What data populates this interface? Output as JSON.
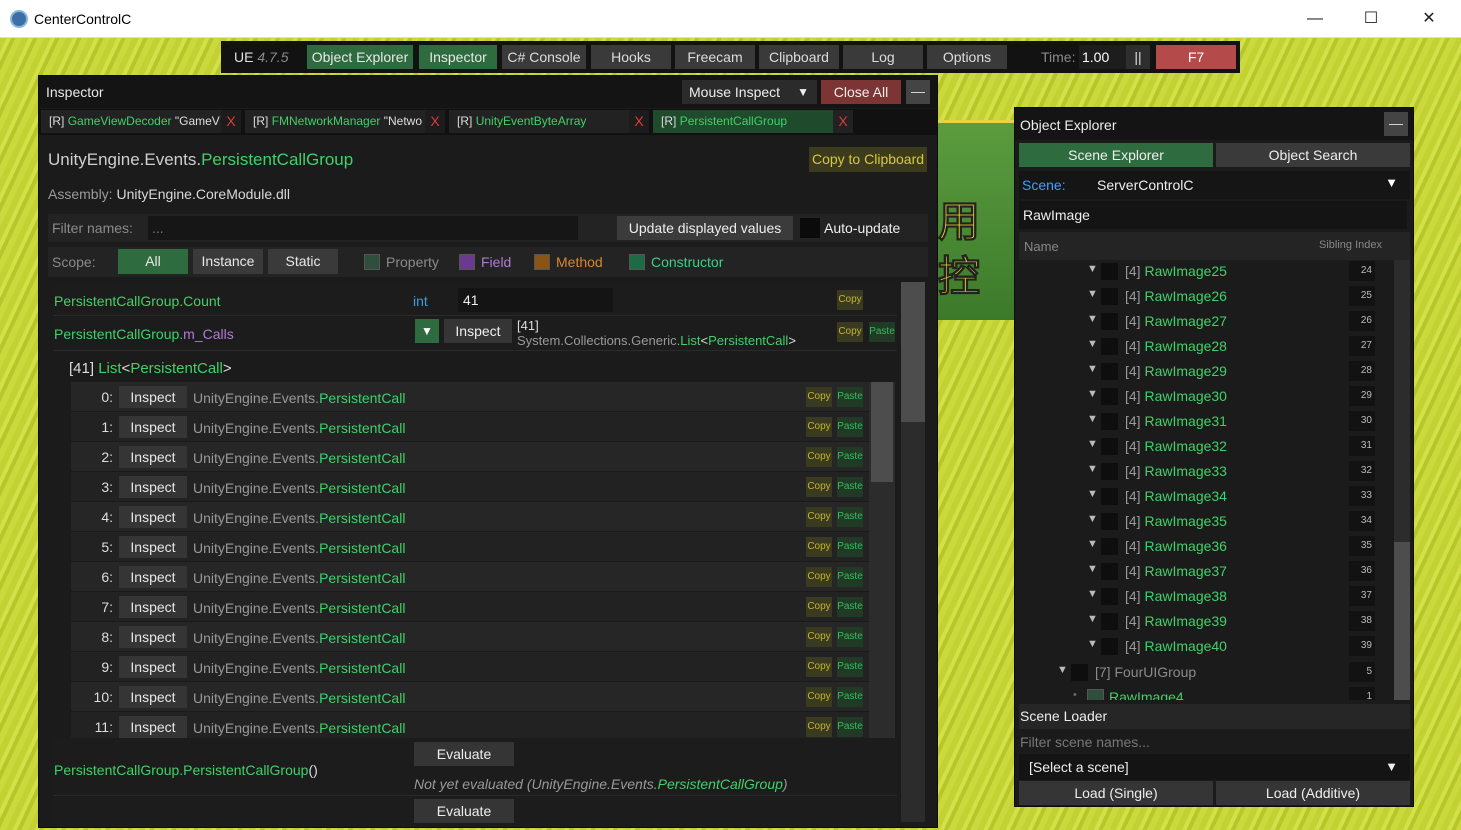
{
  "window": {
    "title": "CenterControlC",
    "minimize": "—",
    "maximize": "☐",
    "close": "✕"
  },
  "background": {
    "cjk_top": "用",
    "cjk_bottom": "控"
  },
  "nav": {
    "ue_label": "UE",
    "ue_version": "4.7.5",
    "buttons": [
      "Object Explorer",
      "Inspector",
      "C# Console",
      "Hooks",
      "Freecam",
      "Clipboard",
      "Log",
      "Options"
    ],
    "time_label": "Time:",
    "time_value": "1.00",
    "pause": "||",
    "f7": "F7"
  },
  "inspector": {
    "title": "Inspector",
    "mouse_inspect": "Mouse Inspect",
    "close_all": "Close All",
    "minimize": "—",
    "tabs": [
      {
        "prefix": "[R]",
        "name": "GameViewDecoder",
        "extra": " \"GameV"
      },
      {
        "prefix": "[R]",
        "name": "FMNetworkManager",
        "extra": " \"Netwo"
      },
      {
        "prefix": "[R]",
        "name": "UnityEventByteArray",
        "extra": ""
      },
      {
        "prefix": "[R]",
        "name": "PersistentCallGroup",
        "extra": ""
      }
    ],
    "tab_close": "X",
    "type_ns": "UnityEngine.Events.",
    "type_name": "PersistentCallGroup",
    "copy_to_clipboard": "Copy to Clipboard",
    "assembly_label": "Assembly:",
    "assembly_value": "UnityEngine.CoreModule.dll",
    "filter_label": "Filter names:",
    "filter_placeholder": "...",
    "update_values": "Update displayed values",
    "auto_update": "Auto-update",
    "scope_label": "Scope:",
    "scope_buttons": [
      "All",
      "Instance",
      "Static"
    ],
    "filters": [
      {
        "label": "Property",
        "color": "#2f4e3c",
        "text": "#8a8a8a"
      },
      {
        "label": "Field",
        "color": "#6b3a8f",
        "text": "#b07ad8"
      },
      {
        "label": "Method",
        "color": "#8a5414",
        "text": "#d9862a"
      },
      {
        "label": "Constructor",
        "color": "#1d6b45",
        "text": "#3fcf86"
      }
    ],
    "member1": {
      "owner": "PersistentCallGroup.",
      "name": "Count",
      "type": "int",
      "value": "41"
    },
    "member2": {
      "owner": "PersistentCallGroup.",
      "name": "m_Calls",
      "expand": "▼",
      "inspect": "Inspect",
      "count": "[41]",
      "type_prefix": "System.Collections.Generic.",
      "type_list": "List",
      "type_lt": "<",
      "type_arg": "PersistentCall",
      "type_gt": ">"
    },
    "copy": "Copy",
    "paste": "Paste",
    "list_header": {
      "count": "[41]",
      "list": "List",
      "lt": "<",
      "arg": "PersistentCall",
      "gt": ">"
    },
    "list_items": [
      {
        "index": "0:"
      },
      {
        "index": "1:"
      },
      {
        "index": "2:"
      },
      {
        "index": "3:"
      },
      {
        "index": "4:"
      },
      {
        "index": "5:"
      },
      {
        "index": "6:"
      },
      {
        "index": "7:"
      },
      {
        "index": "8:"
      },
      {
        "index": "9:"
      },
      {
        "index": "10:"
      },
      {
        "index": "11:"
      }
    ],
    "list_inspect": "Inspect",
    "item_ns": "UnityEngine.Events.",
    "item_type": "PersistentCall",
    "method": {
      "owner": "PersistentCallGroup.",
      "name": "PersistentCallGroup",
      "parens": "()",
      "evaluate": "Evaluate",
      "status": "Not yet evaluated",
      "status_ns": "UnityEngine.Events.",
      "status_type": "PersistentCallGroup"
    },
    "evaluate2": "Evaluate"
  },
  "object_explorer": {
    "title": "Object Explorer",
    "minimize": "—",
    "tabs": [
      "Scene Explorer",
      "Object Search"
    ],
    "scene_label": "Scene:",
    "scene_value": "ServerControlC",
    "search_value": "RawImage",
    "col_name": "Name",
    "col_sibling": "Sibling Index",
    "tree": [
      {
        "prefix": "[4]",
        "name": "RawImage25",
        "index": "24"
      },
      {
        "prefix": "[4]",
        "name": "RawImage26",
        "index": "25"
      },
      {
        "prefix": "[4]",
        "name": "RawImage27",
        "index": "26"
      },
      {
        "prefix": "[4]",
        "name": "RawImage28",
        "index": "27"
      },
      {
        "prefix": "[4]",
        "name": "RawImage29",
        "index": "28"
      },
      {
        "prefix": "[4]",
        "name": "RawImage30",
        "index": "29"
      },
      {
        "prefix": "[4]",
        "name": "RawImage31",
        "index": "30"
      },
      {
        "prefix": "[4]",
        "name": "RawImage32",
        "index": "31"
      },
      {
        "prefix": "[4]",
        "name": "RawImage33",
        "index": "32"
      },
      {
        "prefix": "[4]",
        "name": "RawImage34",
        "index": "33"
      },
      {
        "prefix": "[4]",
        "name": "RawImage35",
        "index": "34"
      },
      {
        "prefix": "[4]",
        "name": "RawImage36",
        "index": "35"
      },
      {
        "prefix": "[4]",
        "name": "RawImage37",
        "index": "36"
      },
      {
        "prefix": "[4]",
        "name": "RawImage38",
        "index": "37"
      },
      {
        "prefix": "[4]",
        "name": "RawImage39",
        "index": "38"
      },
      {
        "prefix": "[4]",
        "name": "RawImage40",
        "index": "39"
      }
    ],
    "group": {
      "prefix": "[7]",
      "name": "FourUIGroup",
      "index": "5"
    },
    "leaf": {
      "bullet": "•",
      "name": "RawImage4",
      "index": "1"
    },
    "scene_loader": "Scene Loader",
    "scene_filter_placeholder": "Filter scene names...",
    "select_scene": "[Select a scene]",
    "load_single": "Load (Single)",
    "load_additive": "Load (Additive)"
  },
  "colors": {
    "accent_green": "#40d169",
    "button_green": "#2e6b3e",
    "close_red": "#b54a4a",
    "type_blue": "#3c9ad8",
    "copy_yellow": "#c4b32e"
  }
}
